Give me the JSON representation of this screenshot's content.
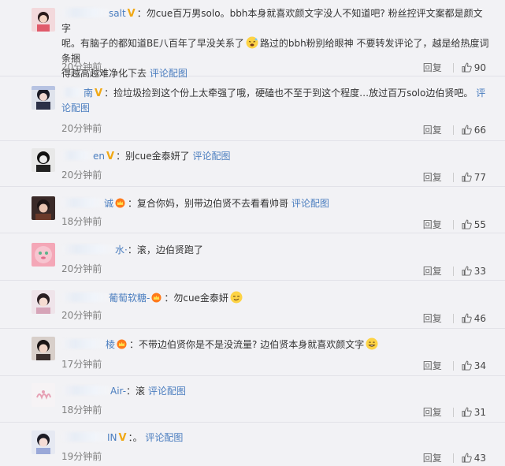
{
  "labels": {
    "reply": "回复",
    "comment_image": "评论配图"
  },
  "comments": [
    {
      "name_visible": "salt",
      "badge": "V",
      "lines": [
        "：勿cue百万男solo。bbh本身就喜欢颜文字没人不知道吧? 粉丝控评文案都是颜文字",
        "呢。有脑子的都知道BE八百年了早没关系了",
        "路过的bbh粉别给眼神 不要转发评论了，越是给热度词条捆",
        "得越高越难净化下去"
      ],
      "time": "20分钟前",
      "likes": "90"
    },
    {
      "name_visible": "南",
      "badge": "V",
      "text": "：捡垃圾捡到这个份上太牵强了哦，硬磕也不至于到这个程度…放过百万solo边伯贤吧。",
      "time": "20分钟前",
      "likes": "66"
    },
    {
      "name_visible": "en",
      "badge": "V",
      "text": "：别cue金泰妍了",
      "time": "20分钟前",
      "likes": "77"
    },
    {
      "name_visible": "诚",
      "badge": "crown",
      "text": "：复合你妈，别带边伯贤不去看看帅哥",
      "time": "18分钟前",
      "likes": "55"
    },
    {
      "name_visible": "水·",
      "badge": "",
      "text": "：滚，边伯贤跑了",
      "time": "20分钟前",
      "likes": "33"
    },
    {
      "name_visible": "葡萄软糖-",
      "badge": "crown",
      "text": "：勿cue金泰妍",
      "time": "20分钟前",
      "likes": "46"
    },
    {
      "name_visible": "棱",
      "badge": "crown",
      "text": "：不带边伯贤你是不是没流量? 边伯贤本身就喜欢颜文字",
      "time": "17分钟前",
      "likes": "34"
    },
    {
      "name_visible": "Air-",
      "badge": "",
      "text": "：滚",
      "time": "18分钟前",
      "likes": "31"
    },
    {
      "name_visible": "IN",
      "badge": "V",
      "text": "：。",
      "time": "19分钟前",
      "likes": "43"
    }
  ],
  "colors": {
    "link": "#4a7dbf",
    "badge_v": "#f0a814",
    "muted": "#808080"
  }
}
